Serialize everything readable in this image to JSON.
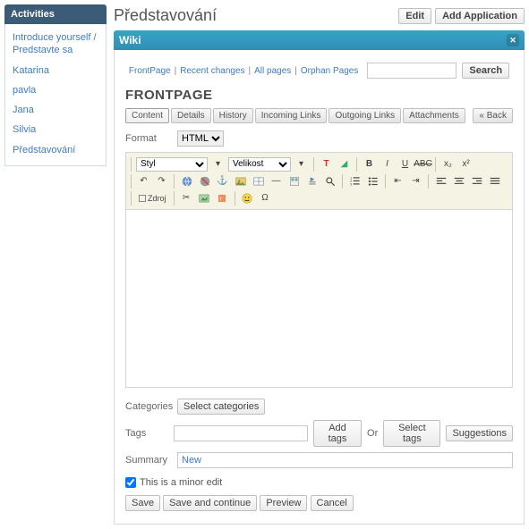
{
  "sidebar": {
    "title": "Activities",
    "items": [
      {
        "label": "Introduce yourself / Predstavte sa"
      },
      {
        "label": "Katarina"
      },
      {
        "label": "pavla"
      },
      {
        "label": "Jana"
      },
      {
        "label": "Silvia"
      },
      {
        "label": "Představování"
      }
    ]
  },
  "header": {
    "title": "Představování",
    "edit": "Edit",
    "add_app": "Add Application"
  },
  "wiki": {
    "label": "Wiki",
    "nav": {
      "frontpage": "FrontPage",
      "recent": "Recent changes",
      "all": "All pages",
      "orphan": "Orphan Pages",
      "search": "Search"
    },
    "page_title": "FRONTPAGE",
    "tabs": {
      "content": "Content",
      "details": "Details",
      "history": "History",
      "incoming": "Incoming Links",
      "outgoing": "Outgoing Links",
      "attachments": "Attachments",
      "back": "« Back"
    },
    "format": {
      "label": "Format",
      "value": "HTML"
    },
    "toolbar": {
      "style_label": "Styl",
      "size_label": "Velikost",
      "source": "Zdroj"
    },
    "categories": {
      "label": "Categories",
      "select": "Select categories"
    },
    "tags": {
      "label": "Tags",
      "value": "",
      "add": "Add tags",
      "or": "Or",
      "select": "Select tags",
      "suggestions": "Suggestions"
    },
    "summary": {
      "label": "Summary",
      "value": "New"
    },
    "minor": {
      "label": "This is a minor edit",
      "checked": true
    },
    "buttons": {
      "save": "Save",
      "save_continue": "Save and continue",
      "preview": "Preview",
      "cancel": "Cancel"
    }
  }
}
